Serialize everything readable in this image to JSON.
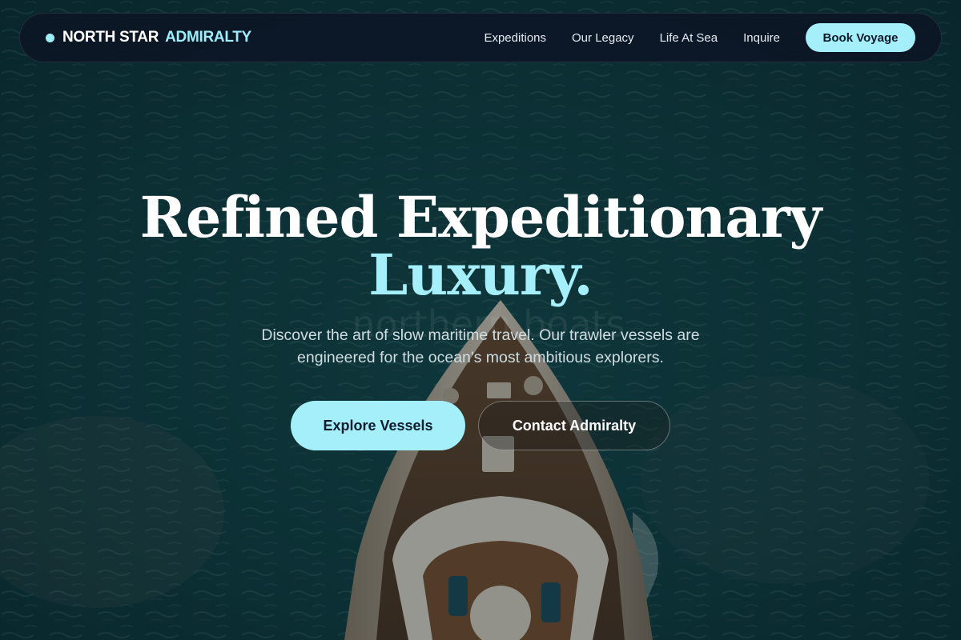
{
  "brand": {
    "name_main": "NORTH STAR",
    "name_accent": "ADMIRALTY",
    "dot_icon": "status-dot-icon"
  },
  "nav": {
    "links": [
      {
        "label": "Expeditions"
      },
      {
        "label": "Our Legacy"
      },
      {
        "label": "Life At Sea"
      },
      {
        "label": "Inquire"
      }
    ],
    "cta_label": "Book Voyage"
  },
  "hero": {
    "title_line1": "Refined Expeditionary",
    "title_line2": "Luxury.",
    "subtitle": "Discover the art of slow maritime travel. Our trawler vessels are engineered for the ocean's most ambitious explorers.",
    "primary_button": "Explore Vessels",
    "secondary_button": "Contact Admiralty",
    "background_watermark": "northern boats"
  },
  "colors": {
    "accent": "#a5effb",
    "nav_bg": "#0d1626",
    "ocean": "#0c3a3e"
  }
}
